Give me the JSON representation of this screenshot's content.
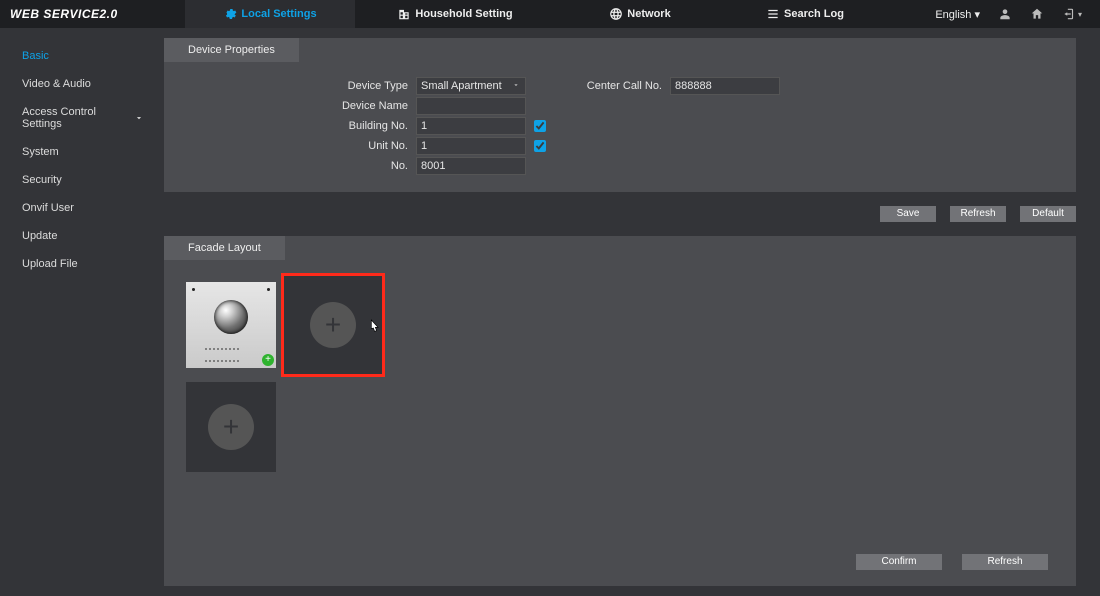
{
  "brand": "WEB SERVICE2.0",
  "nav": {
    "local": "Local Settings",
    "household": "Household Setting",
    "network": "Network",
    "search": "Search Log"
  },
  "lang_label": "English",
  "sidebar": {
    "items": [
      {
        "label": "Basic"
      },
      {
        "label": "Video & Audio"
      },
      {
        "label": "Access Control Settings"
      },
      {
        "label": "System"
      },
      {
        "label": "Security"
      },
      {
        "label": "Onvif User"
      },
      {
        "label": "Update"
      },
      {
        "label": "Upload File"
      }
    ]
  },
  "device_props": {
    "tab": "Device Properties",
    "labels": {
      "device_type": "Device Type",
      "device_name": "Device Name",
      "building_no": "Building No.",
      "unit_no": "Unit No.",
      "no": "No.",
      "center_call": "Center Call No."
    },
    "values": {
      "device_type": "Small Apartment",
      "device_name": "",
      "building_no": "1",
      "unit_no": "1",
      "no": "8001",
      "center_call": "888888"
    }
  },
  "buttons": {
    "save": "Save",
    "refresh": "Refresh",
    "default": "Default",
    "confirm": "Confirm"
  },
  "facade": {
    "tab": "Facade Layout"
  }
}
